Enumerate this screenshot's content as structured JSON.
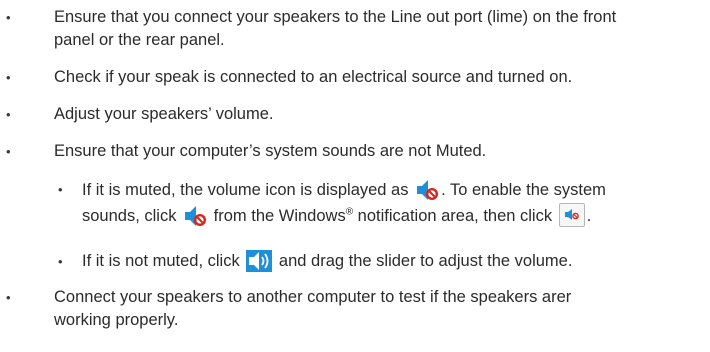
{
  "items": [
    {
      "line1": "Ensure that you connect your speakers to the Line out port (lime) on the front",
      "line2": "panel or the rear panel."
    },
    {
      "text": "Check if your speak is connected to an electrical source and turned on."
    },
    {
      "text": "Adjust your speakers’ volume."
    },
    {
      "text": "Ensure that your computer’s system sounds are not Muted."
    },
    {
      "sub1_a": "If it is muted, the volume icon is displayed as",
      "sub1_b": ". To enable the system",
      "sub1_c": "sounds, click",
      "sub1_d": "from the Windows",
      "sub1_reg": "®",
      "sub1_e": " notification area, then click",
      "sub1_f": "."
    },
    {
      "sub2_a": "If it is not muted, click",
      "sub2_b": "and drag the slider to adjust the volume."
    },
    {
      "line1": "Connect your speakers to another computer to test if the speakers arer",
      "line2": "working properly."
    }
  ],
  "bullet_char": "•",
  "icons": {
    "muted": "speaker-muted-icon",
    "unmuted": "speaker-volume-icon",
    "mute_button": "mute-toggle-button-icon"
  },
  "colors": {
    "text": "#2b2b2b",
    "icon_blue": "#1f8fd8",
    "mute_red": "#d9241c"
  }
}
